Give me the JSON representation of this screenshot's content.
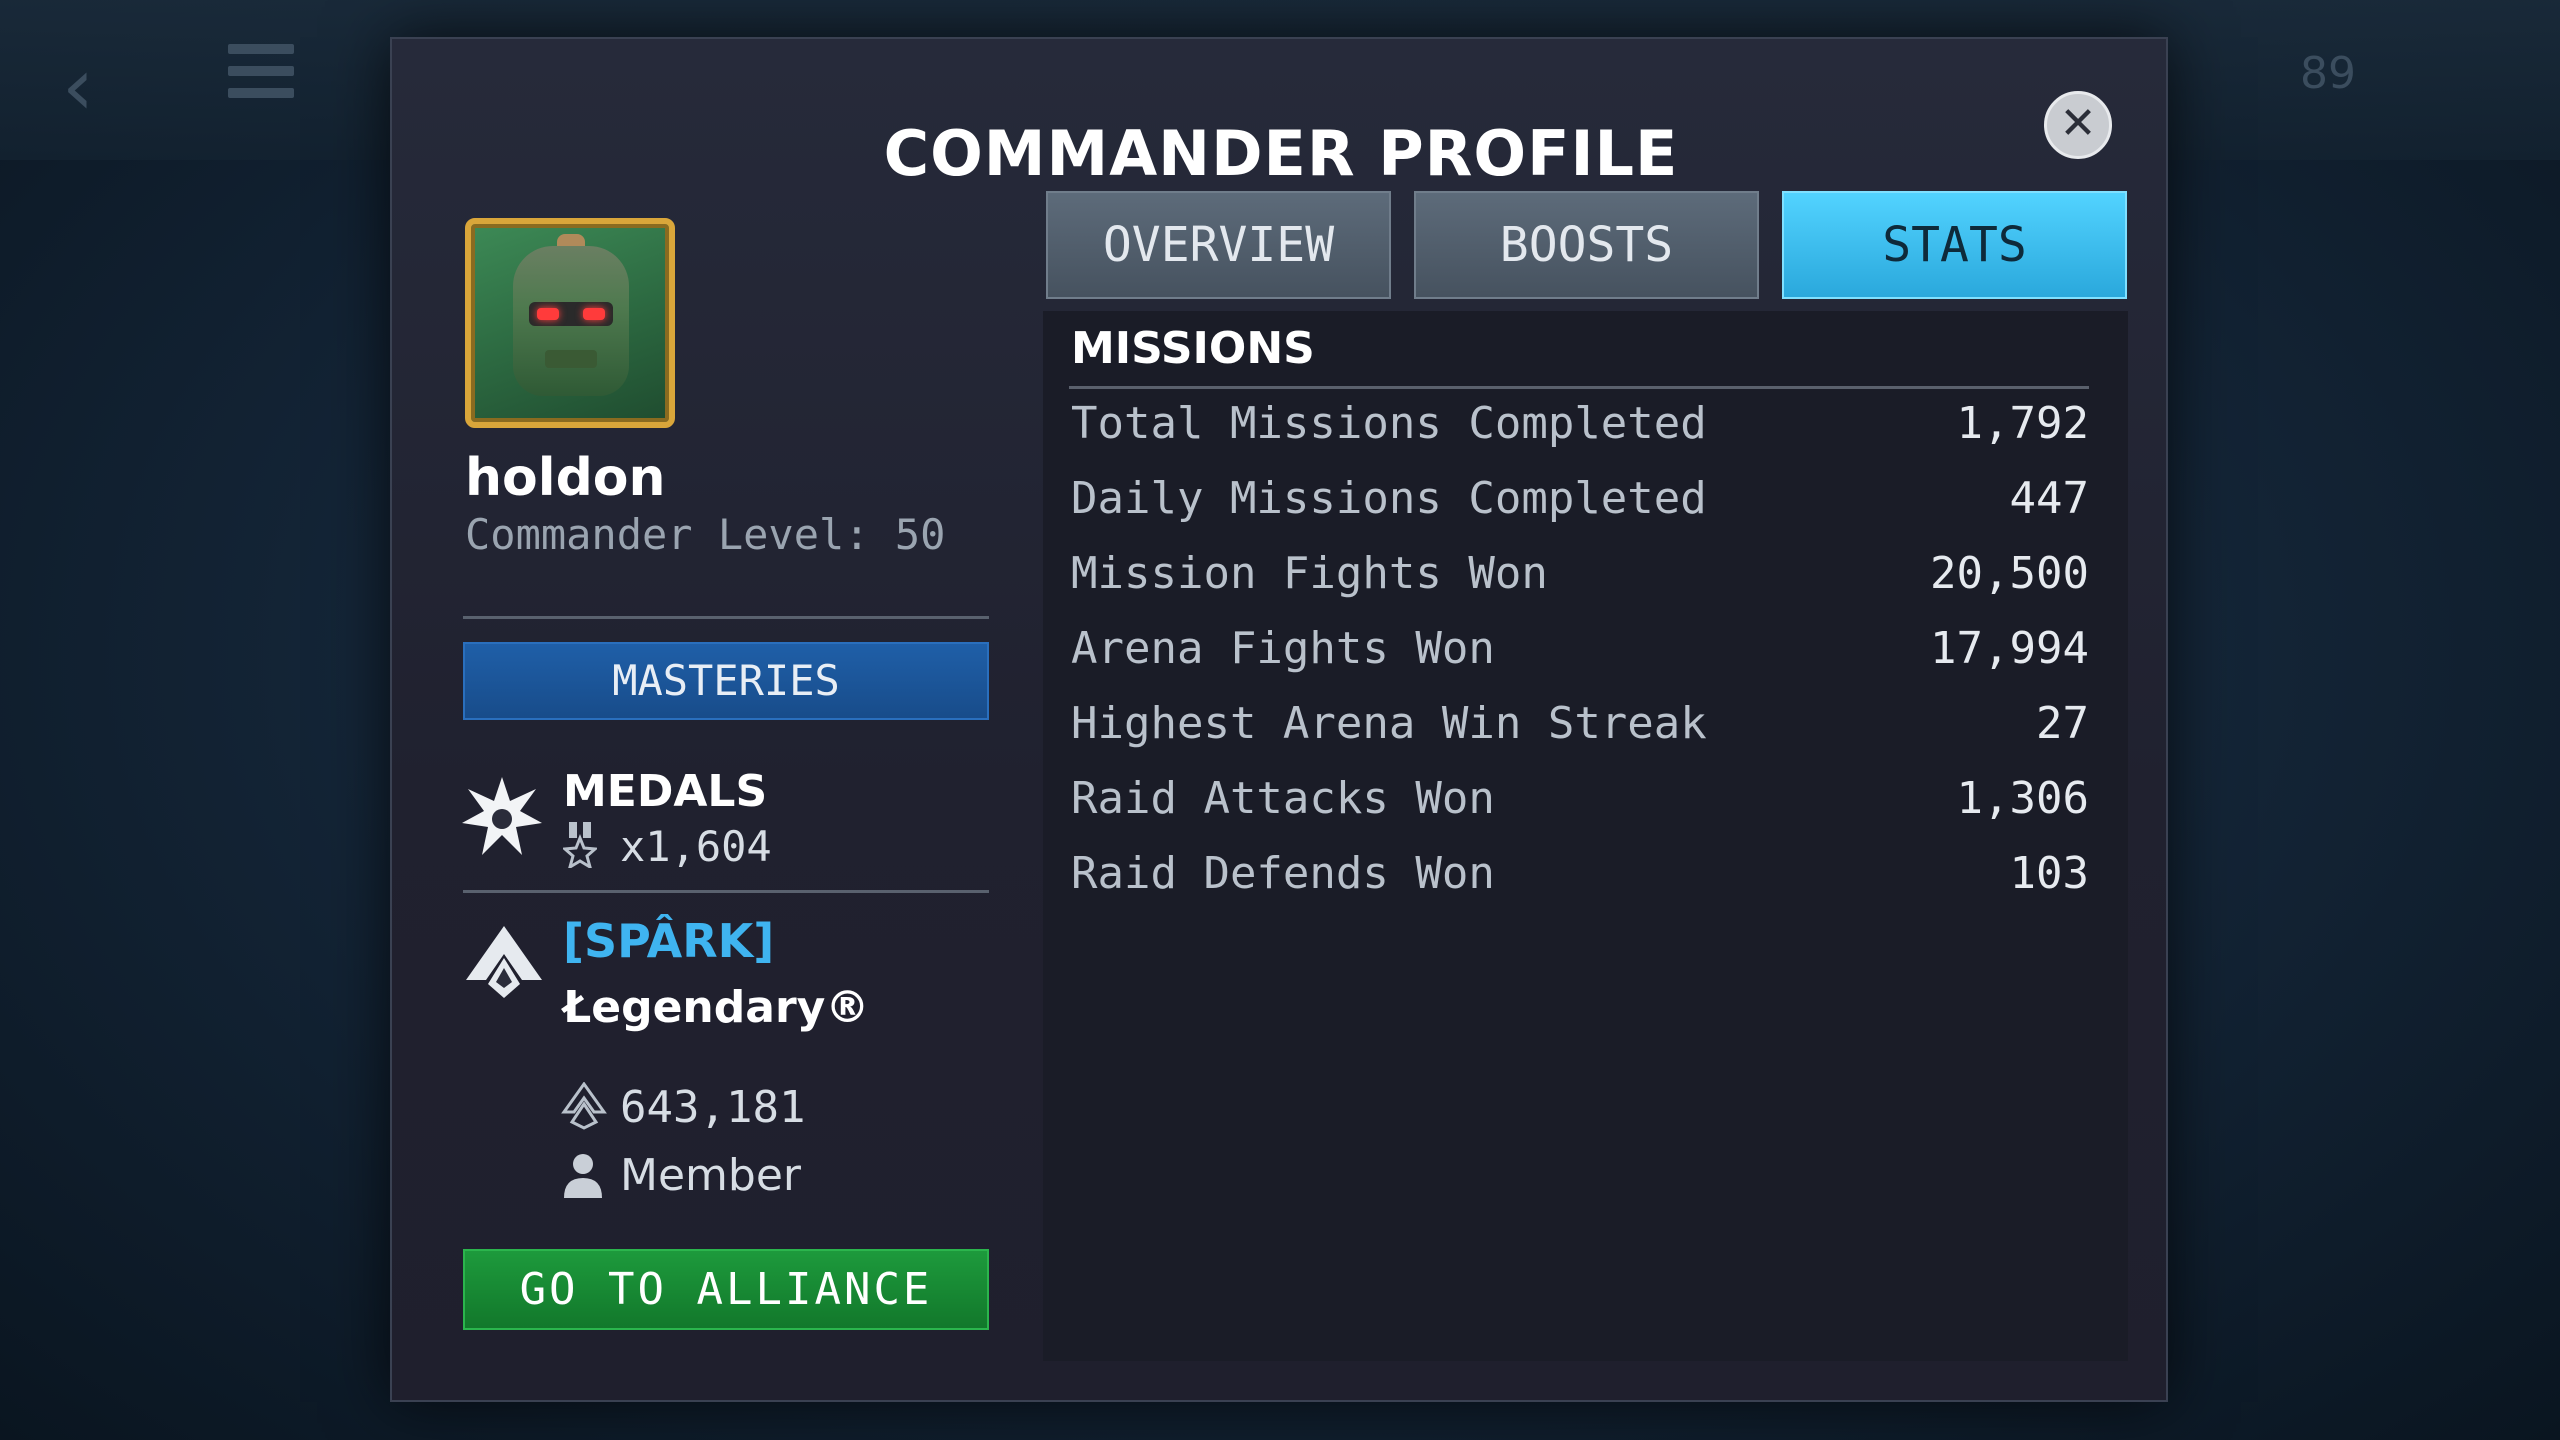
{
  "modal": {
    "title": "COMMANDER PROFILE",
    "close_icon": "close-icon"
  },
  "profile": {
    "name": "holdon",
    "level_text": "Commander Level: 50",
    "masteries_label": "MASTERIES",
    "medals_label": "MEDALS",
    "medals_count": "x1,604"
  },
  "alliance": {
    "tag": "[SPÂRK]",
    "name": "Łegendary®",
    "power": "643,181",
    "role": "Member",
    "button_label": "GO TO ALLIANCE"
  },
  "tabs": [
    {
      "label": "OVERVIEW",
      "active": false
    },
    {
      "label": "BOOSTS",
      "active": false
    },
    {
      "label": "STATS",
      "active": true
    }
  ],
  "stats": {
    "section_title": "MISSIONS",
    "rows": [
      {
        "label": "Total Missions Completed",
        "value": "1,792"
      },
      {
        "label": "Daily Missions Completed",
        "value": "447"
      },
      {
        "label": "Mission Fights Won",
        "value": "20,500"
      },
      {
        "label": "Arena Fights Won",
        "value": "17,994"
      },
      {
        "label": "Highest Arena Win Streak",
        "value": "27"
      },
      {
        "label": "Raid Attacks Won",
        "value": "1,306"
      },
      {
        "label": "Raid Defends Won",
        "value": "103"
      }
    ]
  },
  "background": {
    "counter": "89"
  },
  "colors": {
    "active_tab": "#2aa8dc",
    "alliance_tag": "#3fb4f0",
    "go_button": "#1d9a3c",
    "masteries_button": "#1f5fa8"
  }
}
